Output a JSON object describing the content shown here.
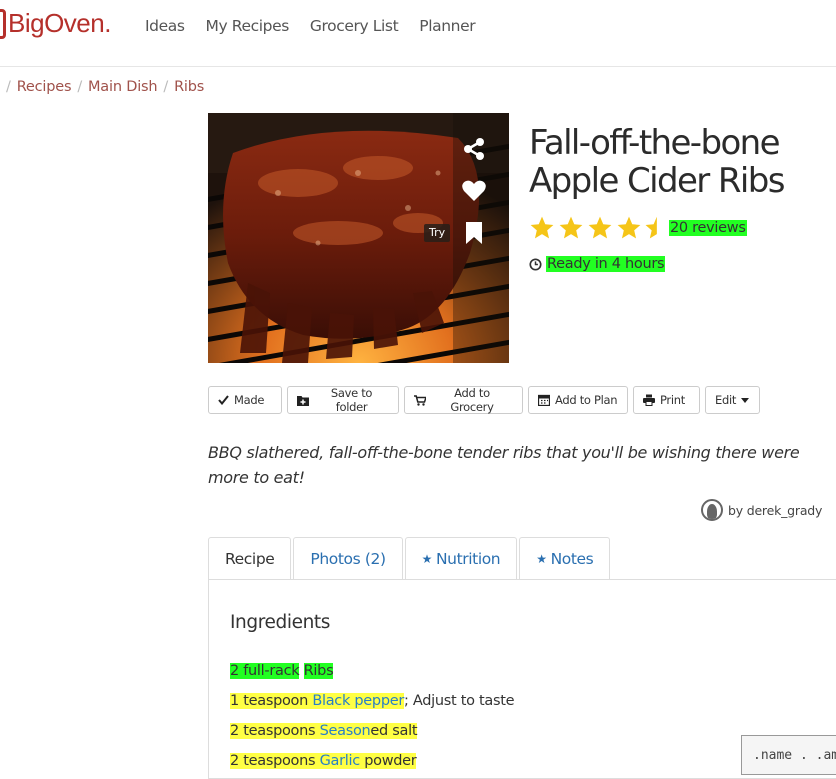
{
  "brand": {
    "name": "BigOven",
    "dot": ".",
    "color": "#b5302b"
  },
  "nav": [
    "Ideas",
    "My Recipes",
    "Grocery List",
    "Planner"
  ],
  "breadcrumb": {
    "lead_sep": "/",
    "items": [
      "Recipes",
      "Main Dish",
      "Ribs"
    ]
  },
  "recipe": {
    "title": "Fall-off-the-bone Apple Cider Ribs",
    "rating": 4.5,
    "reviews": "20 reviews",
    "ready": "Ready in 4 hours",
    "try_label": "Try",
    "description": "BBQ slathered, fall-off-the-bone tender ribs that you'll be wishing there were more to eat!",
    "author": "by derek_grady"
  },
  "actions": {
    "made": "Made",
    "save": "Save to folder",
    "grocery": "Add to Grocery",
    "plan": "Add to Plan",
    "print": "Print",
    "edit": "Edit"
  },
  "tabs": {
    "recipe": "Recipe",
    "photos": "Photos (2)",
    "nutrition": "Nutrition",
    "notes": "Notes"
  },
  "ingredients": {
    "heading": "Ingredients",
    "items": [
      {
        "qty": "2 full-rack",
        "name": "Ribs",
        "rest": ""
      },
      {
        "qty": "1 teaspoon",
        "name": "Black pepper",
        "rest": "; Adjust to taste"
      },
      {
        "qty": "2 teaspoons",
        "name": "Season",
        "rest": "ed salt"
      },
      {
        "qty": "2 teaspoons",
        "name": "Garlic",
        "rest": " powder"
      }
    ]
  },
  "corner_snippet": ".name . .am",
  "colors": {
    "link": "#2a7fc6",
    "highlight_green": "#22ff22",
    "highlight_yellow": "#ffff44",
    "star": "#f5c518"
  }
}
